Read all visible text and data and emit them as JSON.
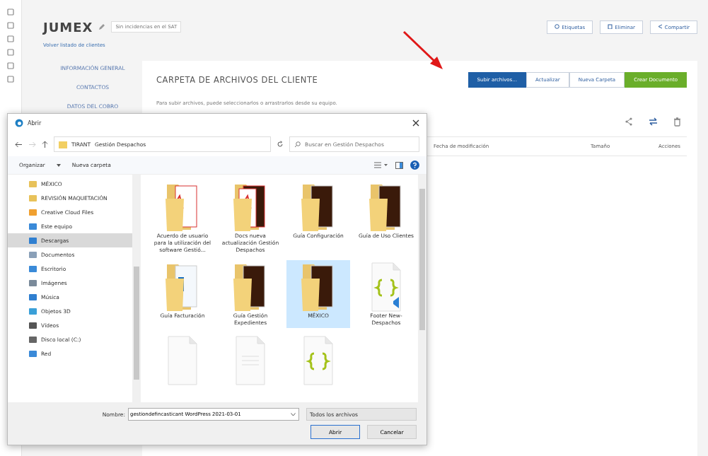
{
  "header": {
    "title": "JUMEX",
    "status": "Sin incidencias en el SAT",
    "back_link": "Volver listado de clientes",
    "buttons": [
      {
        "label": "Etiquetas",
        "kind": "tag"
      },
      {
        "label": "Eliminar",
        "kind": "trash"
      },
      {
        "label": "Compartir",
        "kind": "share"
      }
    ]
  },
  "nav": [
    "INFORMACIÓN GENERAL",
    "CONTACTOS",
    "DATOS DEL COBRO"
  ],
  "panel": {
    "title": "CARPETA DE ARCHIVOS DEL CLIENTE",
    "info": "Para subir archivos, puede seleccionarlos o arrastrarlos desde su equipo.",
    "actions": [
      {
        "label": "Subir archivos...",
        "kind": "primary"
      },
      {
        "label": "Actualizar",
        "kind": "default"
      },
      {
        "label": "Nueva Carpeta",
        "kind": "default"
      },
      {
        "label": "Crear Documento",
        "kind": "success"
      }
    ],
    "columns": [
      "Fecha de modificación",
      "Tamaño",
      "Acciones"
    ]
  },
  "dialog": {
    "title": "Abrir",
    "path": [
      "TIRANT",
      "Gestión Despachos"
    ],
    "search": {
      "placeholder": "Buscar en Gestión Despachos"
    },
    "toolbar": [
      "Organizar",
      "Nueva carpeta"
    ],
    "tree": [
      {
        "label": "MÉXICO",
        "kind": "folder",
        "selected": false
      },
      {
        "label": "REVISIÓN MAQUETACIÓN",
        "kind": "folder",
        "selected": false
      },
      {
        "label": "Creative Cloud Files",
        "kind": "cloud",
        "selected": false
      },
      {
        "label": "Este equipo",
        "kind": "pc",
        "selected": false,
        "children": [
          {
            "label": "Descargas",
            "kind": "download",
            "selected": true
          },
          {
            "label": "Documentos",
            "kind": "docs",
            "selected": false
          },
          {
            "label": "Escritorio",
            "kind": "desktop",
            "selected": false
          },
          {
            "label": "Imágenes",
            "kind": "images",
            "selected": false
          },
          {
            "label": "Música",
            "kind": "music",
            "selected": false
          },
          {
            "label": "Objetos 3D",
            "kind": "cube",
            "selected": false
          },
          {
            "label": "Vídeos",
            "kind": "video",
            "selected": false
          },
          {
            "label": "Disco local (C:)",
            "kind": "disk",
            "selected": false
          }
        ]
      },
      {
        "label": "Red",
        "kind": "network",
        "selected": false
      }
    ],
    "files": [
      {
        "name": "Acuerdo de usuario para la utilización del software Gestió...",
        "kind": "folder_pdf",
        "selected": false
      },
      {
        "name": "Docs nueva actualización Gestión Despachos",
        "kind": "folder_pdf_ai",
        "selected": false
      },
      {
        "name": "Guía Configuración",
        "kind": "folder_ai",
        "selected": false
      },
      {
        "name": "Guía de Uso Clientes",
        "kind": "folder_ai",
        "selected": false
      },
      {
        "name": "Guía Facturación",
        "kind": "folder_doc",
        "selected": false
      },
      {
        "name": "Guía Gestión Expedientes",
        "kind": "folder_ai",
        "selected": false
      },
      {
        "name": "MÉXICO",
        "kind": "folder_blank",
        "selected": true
      },
      {
        "name": "Footer New-Despachos",
        "kind": "code_vs",
        "selected": false
      },
      {
        "kind": "blank_file",
        "selected": false
      },
      {
        "kind": "text_file",
        "selected": false
      },
      {
        "kind": "code_file",
        "selected": false
      }
    ],
    "filename_label": "Nombre:",
    "filename": "gestiondefincasticant WordPress 2021-03-01",
    "filter": "Todos los archivos",
    "buttons": [
      "Abrir",
      "Cancelar"
    ]
  }
}
